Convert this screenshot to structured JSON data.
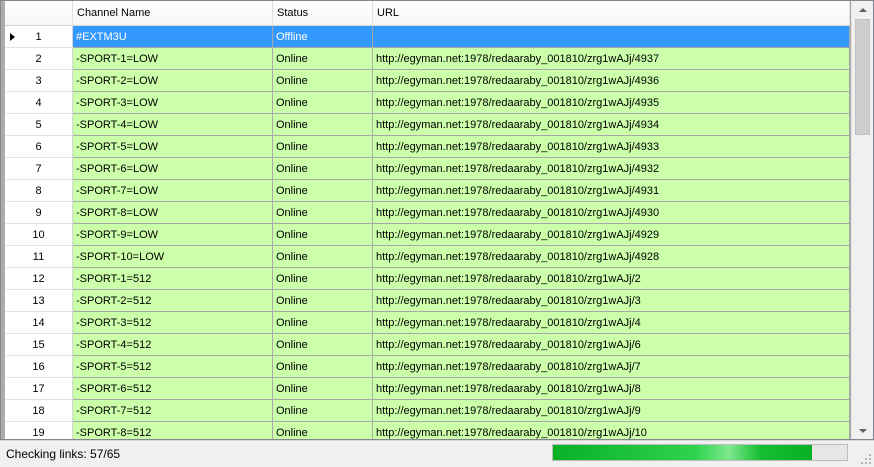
{
  "grid": {
    "columns": [
      "",
      "Channel Name",
      "Status",
      "URL"
    ],
    "rows": [
      {
        "num": "1",
        "name": "#EXTM3U",
        "status": "Offline",
        "url": ""
      },
      {
        "num": "2",
        "name": "-SPORT-1=LOW",
        "status": "Online",
        "url": "http://egyman.net:1978/redaaraby_001810/zrg1wAJj/4937"
      },
      {
        "num": "3",
        "name": "-SPORT-2=LOW",
        "status": "Online",
        "url": "http://egyman.net:1978/redaaraby_001810/zrg1wAJj/4936"
      },
      {
        "num": "4",
        "name": "-SPORT-3=LOW",
        "status": "Online",
        "url": "http://egyman.net:1978/redaaraby_001810/zrg1wAJj/4935"
      },
      {
        "num": "5",
        "name": "-SPORT-4=LOW",
        "status": "Online",
        "url": "http://egyman.net:1978/redaaraby_001810/zrg1wAJj/4934"
      },
      {
        "num": "6",
        "name": "-SPORT-5=LOW",
        "status": "Online",
        "url": "http://egyman.net:1978/redaaraby_001810/zrg1wAJj/4933"
      },
      {
        "num": "7",
        "name": "-SPORT-6=LOW",
        "status": "Online",
        "url": "http://egyman.net:1978/redaaraby_001810/zrg1wAJj/4932"
      },
      {
        "num": "8",
        "name": "-SPORT-7=LOW",
        "status": "Online",
        "url": "http://egyman.net:1978/redaaraby_001810/zrg1wAJj/4931"
      },
      {
        "num": "9",
        "name": "-SPORT-8=LOW",
        "status": "Online",
        "url": "http://egyman.net:1978/redaaraby_001810/zrg1wAJj/4930"
      },
      {
        "num": "10",
        "name": "-SPORT-9=LOW",
        "status": "Online",
        "url": "http://egyman.net:1978/redaaraby_001810/zrg1wAJj/4929"
      },
      {
        "num": "11",
        "name": "-SPORT-10=LOW",
        "status": "Online",
        "url": "http://egyman.net:1978/redaaraby_001810/zrg1wAJj/4928"
      },
      {
        "num": "12",
        "name": "-SPORT-1=512",
        "status": "Online",
        "url": "http://egyman.net:1978/redaaraby_001810/zrg1wAJj/2"
      },
      {
        "num": "13",
        "name": "-SPORT-2=512",
        "status": "Online",
        "url": "http://egyman.net:1978/redaaraby_001810/zrg1wAJj/3"
      },
      {
        "num": "14",
        "name": "-SPORT-3=512",
        "status": "Online",
        "url": "http://egyman.net:1978/redaaraby_001810/zrg1wAJj/4"
      },
      {
        "num": "15",
        "name": "-SPORT-4=512",
        "status": "Online",
        "url": "http://egyman.net:1978/redaaraby_001810/zrg1wAJj/6"
      },
      {
        "num": "16",
        "name": "-SPORT-5=512",
        "status": "Online",
        "url": "http://egyman.net:1978/redaaraby_001810/zrg1wAJj/7"
      },
      {
        "num": "17",
        "name": "-SPORT-6=512",
        "status": "Online",
        "url": "http://egyman.net:1978/redaaraby_001810/zrg1wAJj/8"
      },
      {
        "num": "18",
        "name": "-SPORT-7=512",
        "status": "Online",
        "url": "http://egyman.net:1978/redaaraby_001810/zrg1wAJj/9"
      },
      {
        "num": "19",
        "name": "-SPORT-8=512",
        "status": "Online",
        "url": "http://egyman.net:1978/redaaraby_001810/zrg1wAJj/10"
      }
    ],
    "selected_row": 0,
    "row_color": "#ccffaa",
    "selected_color": "#3399ff"
  },
  "scrollbar": {
    "up_icon": "chevron-up-icon",
    "down_icon": "chevron-down-icon"
  },
  "status": {
    "text": "Checking links: 57/65",
    "progress_fraction": 0.88,
    "progress_color": "#06b025"
  }
}
